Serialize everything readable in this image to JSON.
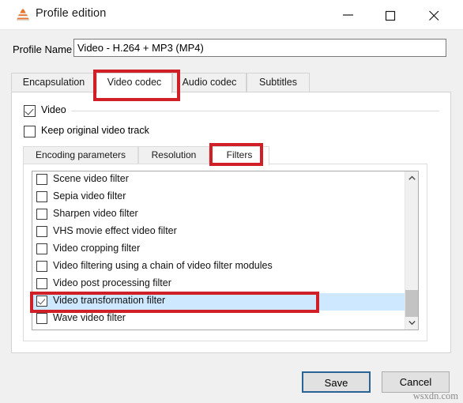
{
  "window": {
    "title": "Profile edition",
    "icon": "vlc-cone-icon",
    "controls": {
      "minimize": "minimize-icon",
      "maximize": "maximize-icon",
      "close": "close-icon"
    }
  },
  "profile": {
    "label": "Profile Name",
    "value": "Video - H.264 + MP3 (MP4)",
    "placeholder": ""
  },
  "outer_tabs": [
    {
      "label": "Encapsulation",
      "selected": false
    },
    {
      "label": "Video codec",
      "selected": true
    },
    {
      "label": "Audio codec",
      "selected": false
    },
    {
      "label": "Subtitles",
      "selected": false
    }
  ],
  "video_section": {
    "video_checkbox": {
      "label": "Video",
      "checked": true
    },
    "keep_original_checkbox": {
      "label": "Keep original video track",
      "checked": false
    }
  },
  "inner_tabs": [
    {
      "label": "Encoding parameters",
      "selected": false
    },
    {
      "label": "Resolution",
      "selected": false
    },
    {
      "label": "Filters",
      "selected": true
    }
  ],
  "filters_list": {
    "rows": [
      {
        "label": "Scene video filter",
        "checked": false,
        "selected": false
      },
      {
        "label": "Sepia video filter",
        "checked": false,
        "selected": false
      },
      {
        "label": "Sharpen video filter",
        "checked": false,
        "selected": false
      },
      {
        "label": "VHS movie effect video filter",
        "checked": false,
        "selected": false
      },
      {
        "label": "Video cropping filter",
        "checked": false,
        "selected": false
      },
      {
        "label": "Video filtering using a chain of video filter modules",
        "checked": false,
        "selected": false
      },
      {
        "label": "Video post processing filter",
        "checked": false,
        "selected": false
      },
      {
        "label": "Video transformation filter",
        "checked": true,
        "selected": true
      },
      {
        "label": "Wave video filter",
        "checked": false,
        "selected": false
      }
    ],
    "scrollbar": {
      "up_arrow": "chevron-up-icon",
      "down_arrow": "chevron-down-icon",
      "thumb_position": "near-bottom"
    }
  },
  "buttons": {
    "save": "Save",
    "cancel": "Cancel"
  },
  "annotations": {
    "color": "#d01f26",
    "boxes": [
      "video-codec-tab",
      "filters-tab",
      "video-transformation-filter-row"
    ]
  },
  "watermark": "wsxdn.com"
}
